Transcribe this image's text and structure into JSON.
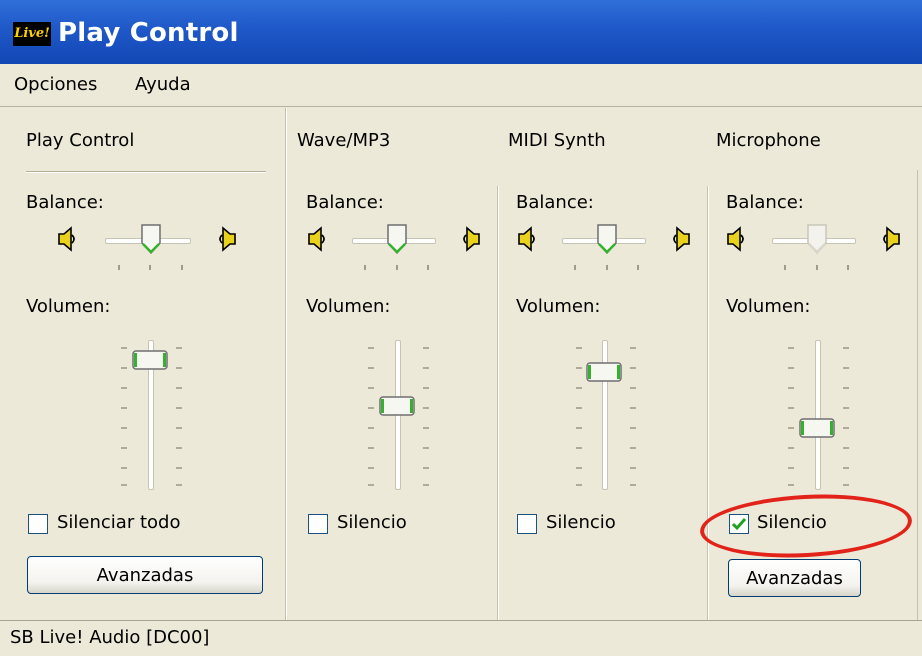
{
  "window": {
    "title": "Play Control",
    "icon_text": "Live!"
  },
  "menu": [
    "Opciones",
    "Ayuda"
  ],
  "columns": [
    {
      "title": "Play Control",
      "balance_label": "Balance:",
      "volume_label": "Volumen:",
      "mute_label": "Silenciar todo",
      "muted": false,
      "button": "Avanzadas",
      "balance_enabled": true
    },
    {
      "title": "Wave/MP3",
      "balance_label": "Balance:",
      "volume_label": "Volumen:",
      "mute_label": "Silencio",
      "muted": false,
      "balance_enabled": true
    },
    {
      "title": "MIDI Synth",
      "balance_label": "Balance:",
      "volume_label": "Volumen:",
      "mute_label": "Silencio",
      "muted": false,
      "balance_enabled": true
    },
    {
      "title": "Microphone",
      "balance_label": "Balance:",
      "volume_label": "Volumen:",
      "mute_label": "Silencio",
      "muted": true,
      "button": "Avanzadas",
      "balance_enabled": false
    }
  ],
  "status": {
    "device": "SB Live! Audio [DC00]"
  },
  "colors": {
    "highlight": "#e2231a",
    "thumb_accent": "#36b12f",
    "title_bar": "#1f58c8"
  },
  "icons": {
    "speaker_left": "speaker-left-icon",
    "speaker_right": "speaker-right-icon",
    "check": "checkmark-icon"
  }
}
